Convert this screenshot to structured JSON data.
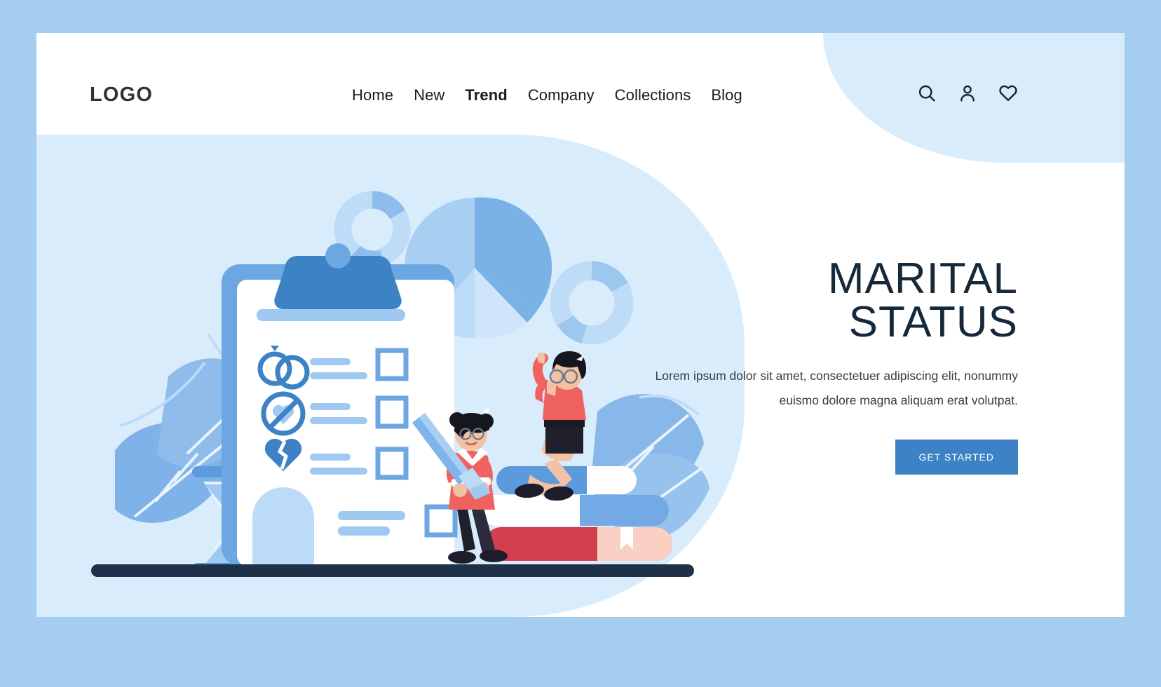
{
  "brand": {
    "logo": "LOGO"
  },
  "nav": {
    "items": [
      {
        "label": "Home",
        "active": false
      },
      {
        "label": "New",
        "active": false
      },
      {
        "label": "Trend",
        "active": true
      },
      {
        "label": "Company",
        "active": false
      },
      {
        "label": "Collections",
        "active": false
      },
      {
        "label": "Blog",
        "active": false
      }
    ]
  },
  "header_icons": [
    {
      "name": "search-icon",
      "label": "Search"
    },
    {
      "name": "user-icon",
      "label": "Account"
    },
    {
      "name": "heart-icon",
      "label": "Favorites"
    }
  ],
  "hero": {
    "title_line1": "MARITAL",
    "title_line2": "STATUS",
    "paragraph": "Lorem ipsum dolor sit amet, consectetuer adipiscing elit, nonummy euismo dolore magna aliquam erat volutpat.",
    "cta_label": "GET STARTED"
  },
  "illustration": {
    "name": "marital-status-illustration",
    "checklist_rows": [
      {
        "icon": "wedding-rings-icon"
      },
      {
        "icon": "no-love-icon"
      },
      {
        "icon": "broken-heart-icon"
      }
    ],
    "objects": [
      "clipboard",
      "pie-chart",
      "donut-chart-small",
      "donut-chart-large",
      "hourglass",
      "leaf-left",
      "leaf-right",
      "book-stack",
      "person-with-pencil",
      "woman-sitting"
    ]
  },
  "colors": {
    "frame": "#a4cdf0",
    "page": "#ffffff",
    "soft_blue_bg": "#d9ecfb",
    "accent_blue": "#3c82c4",
    "mid_blue": "#6ba7e0",
    "light_blue": "#9fc9f0",
    "title_navy": "#16293b",
    "ground_navy": "#1f3148",
    "pink": "#f4726e",
    "red_book": "#d23f4f"
  }
}
